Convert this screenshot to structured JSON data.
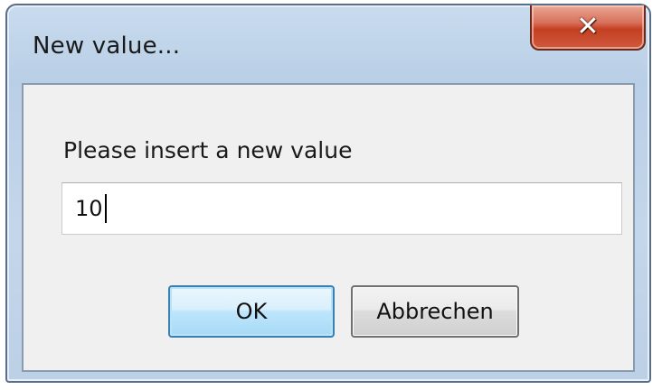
{
  "window": {
    "title": "New value...",
    "close_icon": "close-icon"
  },
  "dialog": {
    "prompt": "Please insert a new value",
    "input_value": "10",
    "ok_label": "OK",
    "cancel_label": "Abbrechen"
  },
  "colors": {
    "close_button": "#c43f22",
    "ok_button_border": "#3c7fb1",
    "client_background": "#f0f0f0"
  }
}
